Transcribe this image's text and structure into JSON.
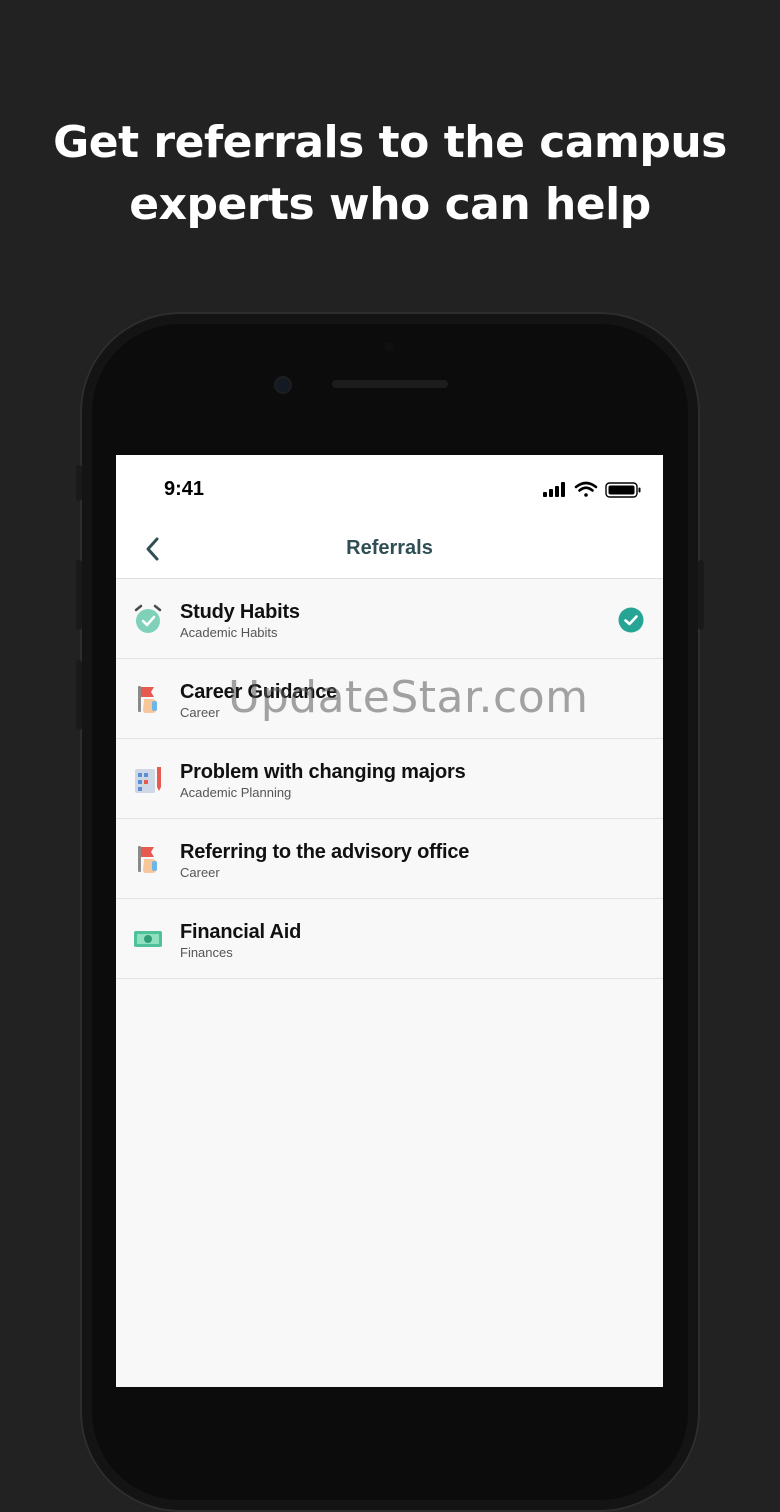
{
  "headline": {
    "line1": "Get referrals to the campus",
    "line2": "experts who can help"
  },
  "status_bar": {
    "time": "9:41",
    "icons": [
      "signal-icon",
      "wifi-icon",
      "battery-icon"
    ]
  },
  "nav": {
    "back_icon": "chevron-left-icon",
    "title": "Referrals"
  },
  "referrals": [
    {
      "title": "Study Habits",
      "subtitle": "Academic Habits",
      "icon": "alarm-clock-icon",
      "selected": true
    },
    {
      "title": "Career Guidance",
      "subtitle": "Career",
      "icon": "career-icon",
      "selected": false
    },
    {
      "title": "Problem with changing majors",
      "subtitle": "Academic Planning",
      "icon": "planning-icon",
      "selected": false
    },
    {
      "title": "Referring to the advisory office",
      "subtitle": "Career",
      "icon": "career-icon",
      "selected": false
    },
    {
      "title": "Financial Aid",
      "subtitle": "Finances",
      "icon": "money-icon",
      "selected": false
    }
  ],
  "watermark": "UpdateStar.com",
  "colors": {
    "accent": "#26a595",
    "nav_title": "#2f4f55",
    "background": "#222222",
    "screen_bg": "#f8f8f8"
  }
}
